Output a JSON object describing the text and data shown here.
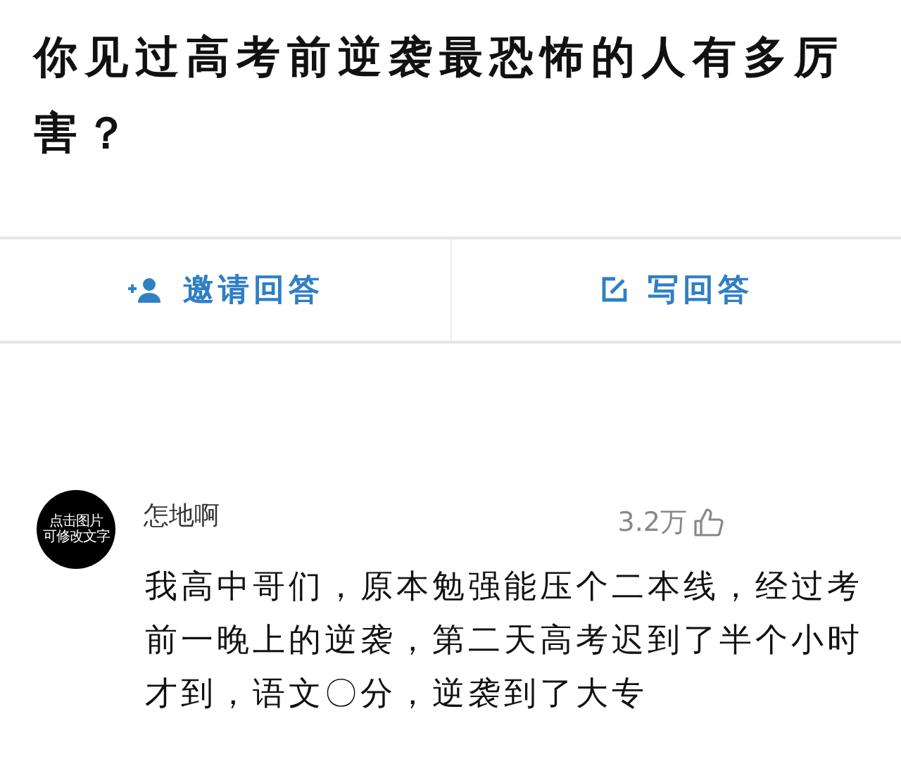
{
  "question": {
    "title": "你见过高考前逆袭最恐怖的人有多厉害？"
  },
  "actions": [
    {
      "kind": "invite",
      "label": "邀请回答"
    },
    {
      "kind": "write",
      "label": "写回答"
    }
  ],
  "answer": {
    "avatar_text": [
      "点击图片",
      "可修改文字"
    ],
    "author": "怎地啊",
    "likes": "3.2万",
    "body": "我高中哥们，原本勉强能压个二本线，经过考前一晚上的逆袭，第二天高考迟到了半个小时才到，语文〇分，逆袭到了大专"
  }
}
